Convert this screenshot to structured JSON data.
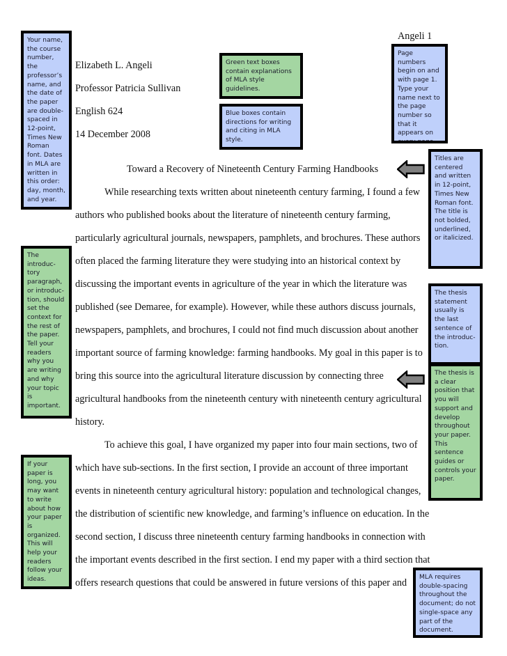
{
  "colors": {
    "blue_box": "#bfd0fb",
    "green_box": "#a4d6a2",
    "border": "#000000",
    "arrow_fill": "#808080"
  },
  "header": {
    "running_head": "Angeli 1"
  },
  "heading": {
    "name": "Elizabeth L. Angeli",
    "professor": "Professor Patricia Sullivan",
    "course": "English 624",
    "date": "14 December 2008"
  },
  "title": "Toward a Recovery of Nineteenth Century Farming Handbooks",
  "body_lines": [
    "While researching texts written about nineteenth century farming, I found a few",
    "authors who published books about the literature of nineteenth century farming,",
    "particularly agricultural journals, newspapers, pamphlets, and brochures. These authors",
    "often placed the farming literature they were studying into an historical context by",
    "discussing the important events in agriculture of the year in which the literature was",
    "published (see Demaree, for example). However, while these authors discuss journals,",
    "newspapers, pamphlets, and brochures, I could not find much discussion about another",
    "important source of farming knowledge: farming handbooks. My goal in this paper is to",
    "bring this source into the agricultural literature discussion by connecting three",
    "agricultural handbooks from the nineteenth century with nineteenth century agricultural",
    "history.",
    "To achieve this goal, I have organized my paper into four main sections, two of",
    "which have sub-sections. In the first section, I provide an account of three important",
    "events in nineteenth century agricultural history: population and technological changes,",
    "the distribution of scientific new knowledge, and farming’s influence on education. In the",
    "second section, I discuss three nineteenth century farming handbooks in connection with",
    "the important events described in the first section. I end my paper with a third section that",
    "offers research questions that could be answered in future versions of this paper and"
  ],
  "notes": {
    "heading_info": "Your name, the course number, the professor’s name, and the date of the paper are double-spaced in 12-point, Times New Roman font. Dates in MLA are written in this order: day, month, and year.",
    "green_legend": "Green text boxes contain explanations of MLA style guidelines.",
    "blue_legend": "Blue boxes contain directions for writing and citing in MLA style.",
    "page_numbers": "Page numbers begin on and with page 1. Type your name next to the page number so that it appears on every page.",
    "titles": "Titles are centered and written in 12-point, Times New Roman font. The title is not bolded, underlined, or italicized.",
    "introduction": "The introduc-tory paragraph, or introduc-tion, should set the context for the rest of the paper. Tell your readers why you are writing and why your topic is important.",
    "thesis_statement": "The thesis statement usually is the last sentence of the introduc-tion.",
    "thesis_position": "The thesis is a clear position that you will support and develop throughout your paper. This sentence guides or controls your paper.",
    "organization": "If your paper is long, you may want to write about how your paper is organized. This will help your readers follow your ideas.",
    "double_spacing": "MLA requires double-spacing throughout the document; do not single-space any part of the document."
  },
  "icons": {
    "title_arrow": "left-arrow-icon",
    "thesis_arrow": "left-arrow-icon"
  }
}
